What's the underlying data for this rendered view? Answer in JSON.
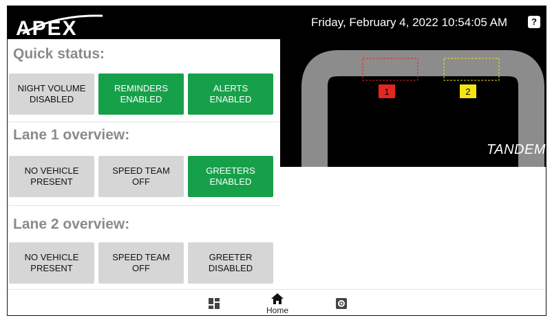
{
  "header": {
    "brand": "APEX",
    "datetime": "Friday, February 4, 2022 10:54:05 AM",
    "help_label": "?"
  },
  "quick_status": {
    "title": "Quick status:",
    "tiles": [
      {
        "label": "NIGHT VOLUME DISABLED",
        "state": "disabled"
      },
      {
        "label": "REMINDERS ENABLED",
        "state": "enabled"
      },
      {
        "label": "ALERTS ENABLED",
        "state": "enabled"
      }
    ]
  },
  "lane1": {
    "title": "Lane 1 overview:",
    "tiles": [
      {
        "label": "NO VEHICLE PRESENT",
        "state": "inactive"
      },
      {
        "label": "SPEED TEAM OFF",
        "state": "inactive"
      },
      {
        "label": "GREETERS ENABLED",
        "state": "enabled"
      }
    ]
  },
  "lane2": {
    "title": "Lane 2 overview:",
    "tiles": [
      {
        "label": "NO VEHICLE PRESENT",
        "state": "inactive"
      },
      {
        "label": "SPEED TEAM OFF",
        "state": "inactive"
      },
      {
        "label": "GREETER DISABLED",
        "state": "disabled"
      }
    ]
  },
  "lane_map": {
    "layout_label": "TANDEM",
    "markers": [
      {
        "label": "1",
        "color": "#e5261f"
      },
      {
        "label": "2",
        "color": "#f3e514"
      }
    ]
  },
  "bottom_nav": {
    "items": [
      {
        "name": "dashboard",
        "label": ""
      },
      {
        "name": "home",
        "label": "Home"
      },
      {
        "name": "settings",
        "label": ""
      }
    ]
  },
  "colors": {
    "enabled": "#17a04a",
    "inactive": "#d6d6d6",
    "header_bg": "#000000",
    "title_gray": "#8a8a8a"
  }
}
